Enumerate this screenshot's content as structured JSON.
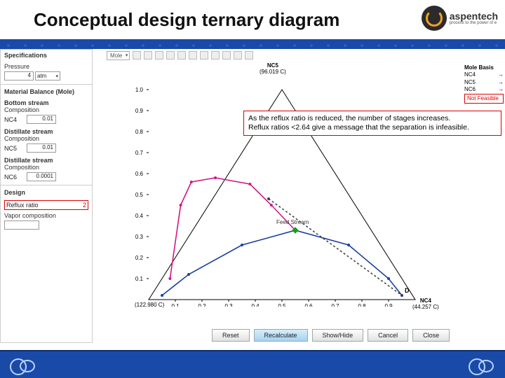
{
  "title": "Conceptual design ternary diagram",
  "logo": {
    "brand": "aspentech",
    "tagline": "process to the power of e"
  },
  "left_panel": {
    "specifications_label": "Specifications",
    "pressure_label": "Pressure",
    "pressure_value": "4",
    "pressure_unit": "atm",
    "material_balance_label": "Material Balance (Mole)",
    "bottom_stream_label": "Bottom stream",
    "composition_label": "Composition",
    "bottom_comp_name": "NC4",
    "bottom_comp_val": "0.01",
    "distillate_stream_label": "Distillate stream",
    "distillate_comp_name": "NC5",
    "distillate_comp_val": "0.01",
    "distillate_stream2_label": "Distillate stream",
    "distillate_comp2_name": "NC6",
    "distillate_comp2_val": "0.0001",
    "design_label": "Design",
    "reflux_label": "Reflux ratio",
    "reflux_value": "2",
    "vapor_comp_label": "Vapor composition"
  },
  "toolbar": {
    "unit_dropdown": "Mole"
  },
  "apex": {
    "top_name": "NC5",
    "top_temp": "(96.019 C)",
    "left_temp": "(122.980 C)",
    "right_name": "NC4",
    "right_temp": "(44.257 C)"
  },
  "legend": {
    "basis_label": "Mole Basis",
    "rows": [
      {
        "n": "NC4",
        "v": "→"
      },
      {
        "n": "NC5",
        "v": "→"
      },
      {
        "n": "NC6",
        "v": "→"
      }
    ],
    "feasible": "Not Feasible"
  },
  "feed_label": "Feed Stream",
  "annotation": {
    "l1": "As the reflux ratio is reduced, the number of stages increases.",
    "l2": "Reflux ratios <2.64 give a message that the separation is infeasible."
  },
  "chart_data": {
    "type": "line",
    "ytick": [
      "0.1",
      "0.2",
      "0.3",
      "0.4",
      "0.5",
      "0.6",
      "0.7",
      "0.8",
      "0.9",
      "1.0"
    ],
    "xtick": [
      "0.1",
      "0.2",
      "0.3",
      "0.4",
      "0.5",
      "0.6",
      "0.7",
      "0.8",
      "0.9"
    ],
    "triangle": [
      [
        0,
        0
      ],
      [
        1,
        0
      ],
      [
        0.5,
        1
      ]
    ],
    "feed_point": [
      0.55,
      0.33
    ],
    "D_point": [
      0.95,
      0.02
    ],
    "D_label": "D",
    "series": [
      {
        "name": "blue-arc",
        "color": "#1b3fa1",
        "values": [
          [
            0.05,
            0.02
          ],
          [
            0.15,
            0.12
          ],
          [
            0.35,
            0.26
          ],
          [
            0.55,
            0.33
          ],
          [
            0.75,
            0.26
          ],
          [
            0.9,
            0.1
          ],
          [
            0.95,
            0.02
          ]
        ]
      },
      {
        "name": "magenta",
        "color": "#d11884",
        "values": [
          [
            0.08,
            0.1
          ],
          [
            0.12,
            0.45
          ],
          [
            0.16,
            0.56
          ],
          [
            0.25,
            0.58
          ],
          [
            0.38,
            0.55
          ],
          [
            0.46,
            0.45
          ],
          [
            0.55,
            0.33
          ]
        ]
      },
      {
        "name": "dashed-right",
        "color": "#444",
        "style": "dashed",
        "values": [
          [
            0.45,
            0.48
          ],
          [
            0.95,
            0.02
          ]
        ]
      }
    ]
  },
  "buttons": {
    "reset": "Reset",
    "recalc": "Recalculate",
    "showhide": "Show/Hide",
    "cancel": "Cancel",
    "close": "Close"
  }
}
